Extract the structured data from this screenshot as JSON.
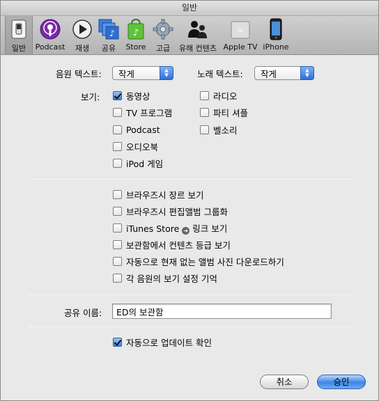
{
  "window": {
    "title": "일반"
  },
  "toolbar": {
    "items": [
      {
        "label": "일반",
        "icon": "switch-icon"
      },
      {
        "label": "Podcast",
        "icon": "podcast-icon"
      },
      {
        "label": "재생",
        "icon": "play-icon"
      },
      {
        "label": "공유",
        "icon": "sharing-icon"
      },
      {
        "label": "Store",
        "icon": "store-bag-icon"
      },
      {
        "label": "고급",
        "icon": "gear-icon"
      },
      {
        "label": "유해 컨텐츠",
        "icon": "parental-icon"
      },
      {
        "label": "Apple TV",
        "icon": "appletv-icon"
      },
      {
        "label": "iPhone",
        "icon": "iphone-icon"
      }
    ],
    "appletv_glyph": "tv"
  },
  "text_size": {
    "source_label": "음원 텍스트:",
    "source_value": "작게",
    "song_label": "노래 텍스트:",
    "song_value": "작게"
  },
  "show": {
    "label": "보기:",
    "left": [
      {
        "label": "동영상",
        "checked": true
      },
      {
        "label": "TV 프로그램",
        "checked": false
      },
      {
        "label": "Podcast",
        "checked": false
      },
      {
        "label": "오디오북",
        "checked": false
      },
      {
        "label": "iPod 게임",
        "checked": false
      }
    ],
    "right": [
      {
        "label": "라디오",
        "checked": false
      },
      {
        "label": "파티 셔플",
        "checked": false
      },
      {
        "label": "벨소리",
        "checked": false
      }
    ]
  },
  "options": [
    {
      "label": "브라우즈시 장르 보기",
      "checked": false
    },
    {
      "label": "브라우즈시 편집앨범 그룹화",
      "checked": false
    },
    {
      "label_pre": "iTunes Store",
      "label_post": "링크 보기",
      "checked": false
    },
    {
      "label": "보관함에서 컨텐츠 등급 보기",
      "checked": false
    },
    {
      "label": "자동으로 현재 없는 앨범 사진 다운로드하기",
      "checked": false
    },
    {
      "label": "각 음원의 보기 설정 기억",
      "checked": false
    }
  ],
  "sharing": {
    "label": "공유 이름:",
    "value": "ED의 보관함"
  },
  "updates": {
    "label": "자동으로 업데이트 확인",
    "checked": true
  },
  "buttons": {
    "cancel": "취소",
    "ok": "승인"
  },
  "colors": {
    "accent": "#3d86e8",
    "checkbox_checked": "#3c7fdc"
  }
}
